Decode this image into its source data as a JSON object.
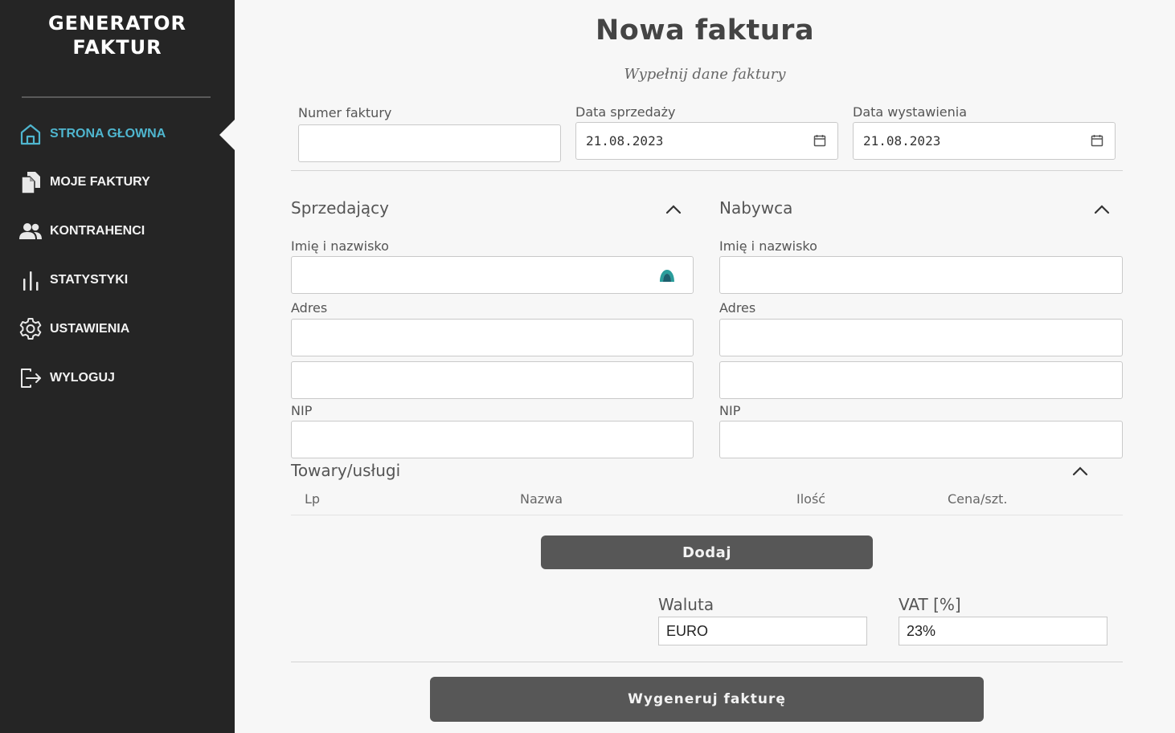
{
  "app": {
    "logo_line1": "GENERATOR",
    "logo_line2": "FAKTUR"
  },
  "sidebar": {
    "items": [
      {
        "label": "STRONA GŁOWNA",
        "icon": "home-icon",
        "active": true
      },
      {
        "label": "MOJE FAKTURY",
        "icon": "documents-icon"
      },
      {
        "label": "KONTRAHENCI",
        "icon": "users-icon"
      },
      {
        "label": "STATYSTYKI",
        "icon": "bar-chart-icon"
      },
      {
        "label": "USTAWIENIA",
        "icon": "gear-icon"
      },
      {
        "label": "WYLOGUJ",
        "icon": "logout-icon"
      }
    ],
    "accent_color": "#4fb6cf"
  },
  "header": {
    "title": "Nowa faktura",
    "subtitle": "Wypełnij dane faktury"
  },
  "invoice": {
    "number_label": "Numer faktury",
    "number_value": "",
    "sale_date_label": "Data sprzedaży",
    "sale_date_value": "21.08.2023",
    "issue_date_label": "Data wystawienia",
    "issue_date_value": "21.08.2023"
  },
  "seller": {
    "title": "Sprzedający",
    "name_label": "Imię i nazwisko",
    "address_label": "Adres",
    "nip_label": "NIP"
  },
  "buyer": {
    "title": "Nabywca",
    "name_label": "Imię i nazwisko",
    "address_label": "Adres",
    "nip_label": "NIP"
  },
  "items": {
    "title": "Towary/usługi",
    "columns": [
      "Lp",
      "Nazwa",
      "Ilość",
      "Cena/szt."
    ],
    "add_button": "Dodaj"
  },
  "summary": {
    "currency_label": "Waluta",
    "currency_value": "EURO",
    "vat_label": "VAT [%]",
    "vat_value": "23%"
  },
  "generate_button": "Wygeneruj fakturę"
}
